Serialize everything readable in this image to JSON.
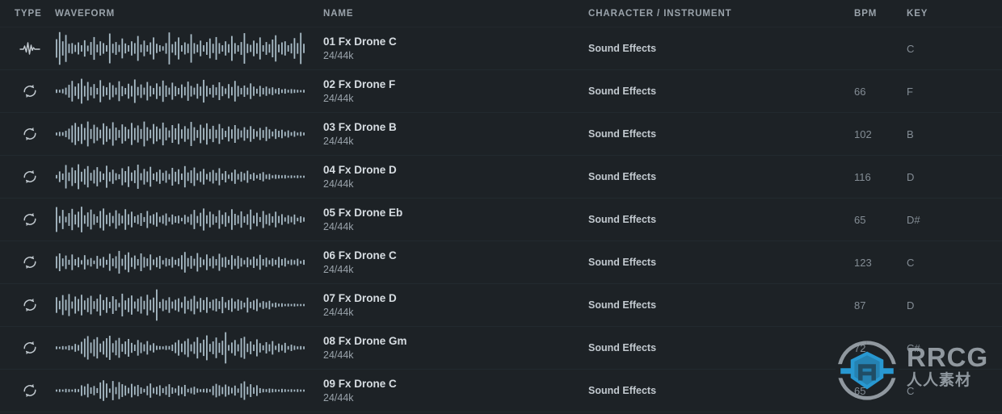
{
  "columns": {
    "type": "TYPE",
    "waveform": "WAVEFORM",
    "name": "NAME",
    "character": "CHARACTER / INSTRUMENT",
    "bpm": "BPM",
    "key": "KEY"
  },
  "colors": {
    "background": "#1d2226",
    "row_divider": "#222a2f",
    "header_text": "#9aa3ab",
    "title_text": "#d7dde2",
    "muted_text": "#848d95",
    "waveform_bar": "#a9bcc7",
    "watermark_blue": "#29a3e0",
    "watermark_grey": "#9aa3aa"
  },
  "rows": [
    {
      "type_icon": "waveform-oneshot-icon",
      "name": "01 Fx Drone C",
      "format": "24/44k",
      "character": "Sound Effects",
      "bpm": "",
      "key": "C",
      "wave": [
        52,
        92,
        40,
        76,
        26,
        30,
        20,
        34,
        18,
        46,
        16,
        36,
        64,
        22,
        40,
        30,
        18,
        84,
        26,
        36,
        20,
        56,
        28,
        18,
        40,
        30,
        70,
        22,
        44,
        18,
        34,
        62,
        26,
        18,
        12,
        30,
        90,
        24,
        38,
        62,
        18,
        34,
        26,
        80,
        30,
        22,
        44,
        18,
        36,
        56,
        26,
        64,
        30,
        18,
        40,
        24,
        70,
        30,
        18,
        36,
        86,
        26,
        20,
        44,
        30,
        62,
        18,
        36,
        24,
        50,
        74,
        22,
        34,
        40,
        18,
        28,
        58,
        30,
        88,
        26
      ]
    },
    {
      "type_icon": "loop-icon",
      "name": "02 Fx Drone F",
      "format": "24/44k",
      "character": "Sound Effects",
      "bpm": "66",
      "key": "F",
      "wave": [
        10,
        8,
        12,
        20,
        36,
        58,
        26,
        44,
        70,
        30,
        52,
        24,
        40,
        18,
        62,
        30,
        22,
        48,
        34,
        20,
        56,
        28,
        18,
        42,
        30,
        66,
        24,
        38,
        20,
        52,
        30,
        18,
        44,
        26,
        60,
        32,
        20,
        48,
        28,
        18,
        38,
        24,
        54,
        30,
        20,
        42,
        26,
        64,
        30,
        18,
        36,
        22,
        50,
        28,
        16,
        40,
        24,
        58,
        30,
        18,
        32,
        20,
        44,
        26,
        14,
        30,
        18,
        26,
        16,
        22,
        12,
        18,
        10,
        14,
        8,
        12,
        10,
        8,
        6,
        8
      ]
    },
    {
      "type_icon": "loop-icon",
      "name": "03 Fx Drone B",
      "format": "24/44k",
      "character": "Sound Effects",
      "bpm": "102",
      "key": "B",
      "wave": [
        8,
        12,
        10,
        18,
        30,
        48,
        62,
        40,
        56,
        34,
        70,
        28,
        52,
        38,
        24,
        60,
        44,
        30,
        66,
        36,
        22,
        54,
        40,
        26,
        62,
        34,
        48,
        28,
        70,
        38,
        24,
        56,
        42,
        30,
        64,
        36,
        20,
        50,
        32,
        58,
        26,
        44,
        30,
        68,
        38,
        22,
        52,
        34,
        60,
        28,
        46,
        24,
        56,
        32,
        18,
        42,
        26,
        50,
        30,
        20,
        38,
        24,
        44,
        28,
        16,
        34,
        22,
        40,
        26,
        14,
        28,
        18,
        24,
        12,
        20,
        10,
        16,
        8,
        12,
        8
      ]
    },
    {
      "type_icon": "loop-icon",
      "name": "04 Fx Drone D",
      "format": "24/44k",
      "character": "Sound Effects",
      "bpm": "116",
      "key": "D",
      "wave": [
        10,
        30,
        18,
        66,
        24,
        52,
        36,
        70,
        28,
        44,
        60,
        22,
        38,
        54,
        30,
        18,
        62,
        26,
        40,
        20,
        14,
        48,
        32,
        58,
        24,
        36,
        68,
        20,
        44,
        30,
        56,
        18,
        26,
        40,
        22,
        34,
        16,
        50,
        28,
        42,
        18,
        60,
        24,
        36,
        52,
        20,
        30,
        44,
        16,
        26,
        38,
        22,
        48,
        18,
        32,
        12,
        24,
        40,
        16,
        28,
        20,
        34,
        14,
        22,
        10,
        18,
        26,
        12,
        16,
        8,
        12,
        10,
        8,
        10,
        6,
        8,
        6,
        8,
        6,
        6
      ]
    },
    {
      "type_icon": "loop-icon",
      "name": "05 Fx Drone Eb",
      "format": "24/44k",
      "character": "Sound Effects",
      "bpm": "65",
      "key": "D#",
      "wave": [
        70,
        20,
        54,
        16,
        36,
        60,
        28,
        44,
        72,
        24,
        40,
        56,
        30,
        18,
        48,
        62,
        26,
        38,
        20,
        52,
        34,
        22,
        58,
        30,
        44,
        18,
        26,
        36,
        14,
        48,
        22,
        30,
        40,
        16,
        24,
        34,
        12,
        28,
        18,
        22,
        10,
        26,
        16,
        30,
        54,
        20,
        38,
        62,
        24,
        44,
        30,
        18,
        52,
        26,
        40,
        20,
        58,
        32,
        24,
        46,
        18,
        30,
        56,
        22,
        38,
        14,
        48,
        26,
        34,
        18,
        44,
        20,
        30,
        12,
        24,
        16,
        28,
        10,
        18,
        12
      ]
    },
    {
      "type_icon": "loop-icon",
      "name": "06 Fx Drone C",
      "format": "24/44k",
      "character": "Sound Effects",
      "bpm": "123",
      "key": "C",
      "wave": [
        34,
        50,
        22,
        38,
        14,
        44,
        18,
        28,
        12,
        40,
        16,
        24,
        10,
        36,
        20,
        30,
        14,
        48,
        22,
        34,
        64,
        20,
        42,
        56,
        26,
        38,
        18,
        50,
        30,
        22,
        44,
        16,
        28,
        36,
        12,
        24,
        18,
        30,
        14,
        22,
        40,
        58,
        24,
        36,
        20,
        52,
        28,
        16,
        44,
        22,
        34,
        18,
        48,
        26,
        30,
        14,
        40,
        20,
        36,
        24,
        12,
        28,
        16,
        32,
        20,
        42,
        18,
        26,
        12,
        22,
        14,
        30,
        18,
        24,
        10,
        16,
        12,
        20,
        8,
        14
      ]
    },
    {
      "type_icon": "loop-icon",
      "name": "07 Fx Drone D",
      "format": "24/44k",
      "character": "Sound Effects",
      "bpm": "87",
      "key": "D",
      "wave": [
        44,
        24,
        56,
        30,
        62,
        20,
        48,
        34,
        58,
        26,
        40,
        52,
        22,
        36,
        60,
        28,
        44,
        18,
        50,
        32,
        12,
        64,
        26,
        40,
        54,
        20,
        36,
        48,
        24,
        58,
        30,
        42,
        88,
        18,
        34,
        26,
        44,
        20,
        30,
        38,
        16,
        48,
        24,
        34,
        52,
        20,
        40,
        28,
        44,
        18,
        30,
        36,
        22,
        46,
        16,
        28,
        38,
        20,
        32,
        24,
        14,
        42,
        18,
        26,
        34,
        12,
        22,
        16,
        24,
        10,
        14,
        8,
        10,
        6,
        8,
        6,
        8,
        6,
        6,
        6
      ]
    },
    {
      "type_icon": "loop-icon",
      "name": "08 Fx Drone Gm",
      "format": "24/44k",
      "character": "Sound Effects",
      "bpm": "72",
      "key": "C#",
      "wave": [
        8,
        6,
        10,
        8,
        14,
        10,
        22,
        16,
        34,
        52,
        66,
        30,
        48,
        60,
        24,
        38,
        54,
        68,
        26,
        42,
        56,
        22,
        36,
        50,
        28,
        18,
        44,
        30,
        20,
        38,
        16,
        26,
        12,
        10,
        8,
        12,
        10,
        18,
        30,
        44,
        24,
        38,
        52,
        20,
        34,
        60,
        26,
        46,
        70,
        22,
        36,
        58,
        28,
        40,
        88,
        16,
        30,
        44,
        20,
        54,
        62,
        24,
        36,
        18,
        48,
        26,
        14,
        32,
        20,
        38,
        12,
        24,
        16,
        28,
        10,
        18,
        12,
        8,
        10,
        8
      ]
    },
    {
      "type_icon": "loop-icon",
      "name": "09 Fx Drone C",
      "format": "24/44k",
      "character": "Sound Effects",
      "bpm": "65",
      "key": "C",
      "wave": [
        6,
        8,
        6,
        10,
        8,
        6,
        10,
        8,
        30,
        24,
        38,
        18,
        26,
        14,
        46,
        58,
        40,
        12,
        54,
        20,
        48,
        36,
        28,
        16,
        38,
        24,
        32,
        18,
        10,
        26,
        40,
        16,
        22,
        30,
        14,
        24,
        36,
        18,
        12,
        28,
        20,
        32,
        10,
        16,
        22,
        12,
        8,
        10,
        12,
        8,
        26,
        38,
        30,
        20,
        34,
        24,
        16,
        28,
        12,
        40,
        52,
        22,
        36,
        18,
        30,
        14,
        10,
        8,
        12,
        10,
        8,
        6,
        10,
        8,
        6,
        8,
        6,
        8,
        6,
        6
      ]
    }
  ],
  "watermark": {
    "brand": "RRCG",
    "brand_cn": "人人素材"
  }
}
